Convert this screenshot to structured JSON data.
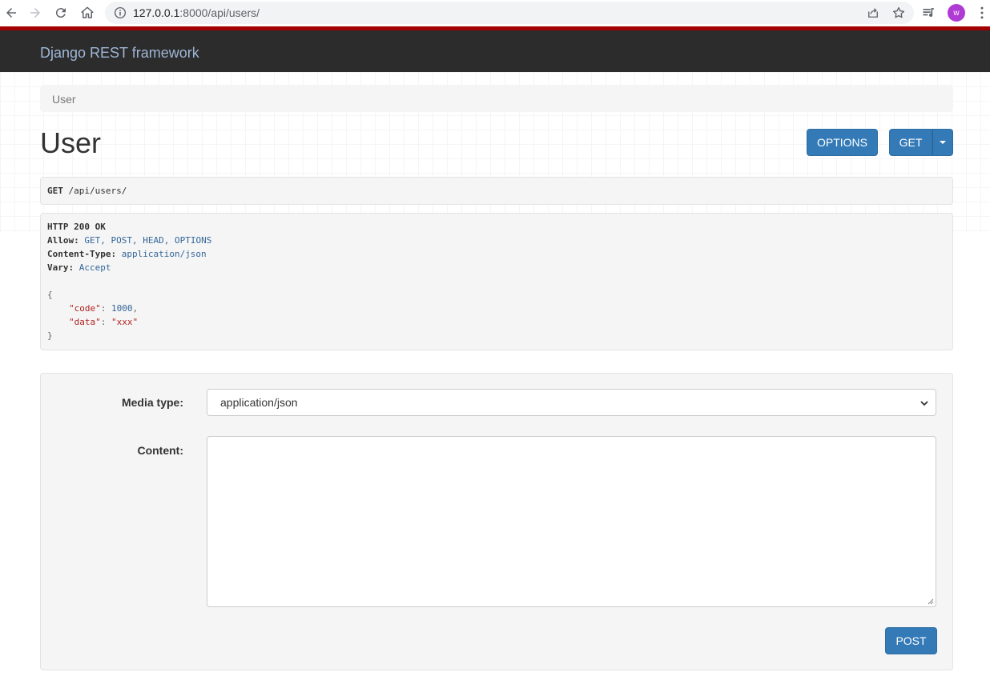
{
  "browser": {
    "url_host": "127.0.0.1",
    "url_rest": ":8000/api/users/",
    "avatar_letter": "w"
  },
  "navbar": {
    "brand": "Django REST framework",
    "brand_color": "#9fb6d6",
    "accent_color": "#a30000"
  },
  "breadcrumb": {
    "items": [
      "User"
    ]
  },
  "page": {
    "title": "User"
  },
  "toolbar": {
    "options_label": "OPTIONS",
    "get_label": "GET",
    "button_color": "#337ab7"
  },
  "request": {
    "method": "GET",
    "path": "/api/users/"
  },
  "response": {
    "status": "HTTP 200 OK",
    "headers": [
      {
        "name": "Allow:",
        "value": "GET, POST, HEAD, OPTIONS"
      },
      {
        "name": "Content-Type:",
        "value": "application/json"
      },
      {
        "name": "Vary:",
        "value": "Accept"
      }
    ],
    "body_open": "{",
    "body_close": "}",
    "body_fields": [
      {
        "key": "\"code\"",
        "sep": ": ",
        "value": "1000",
        "trail": ","
      },
      {
        "key": "\"data\"",
        "sep": ": ",
        "value": "\"xxx\"",
        "trail": ""
      }
    ]
  },
  "form": {
    "media_type_label": "Media type:",
    "media_type_value": "application/json",
    "content_label": "Content:",
    "content_value": "",
    "post_label": "POST"
  }
}
